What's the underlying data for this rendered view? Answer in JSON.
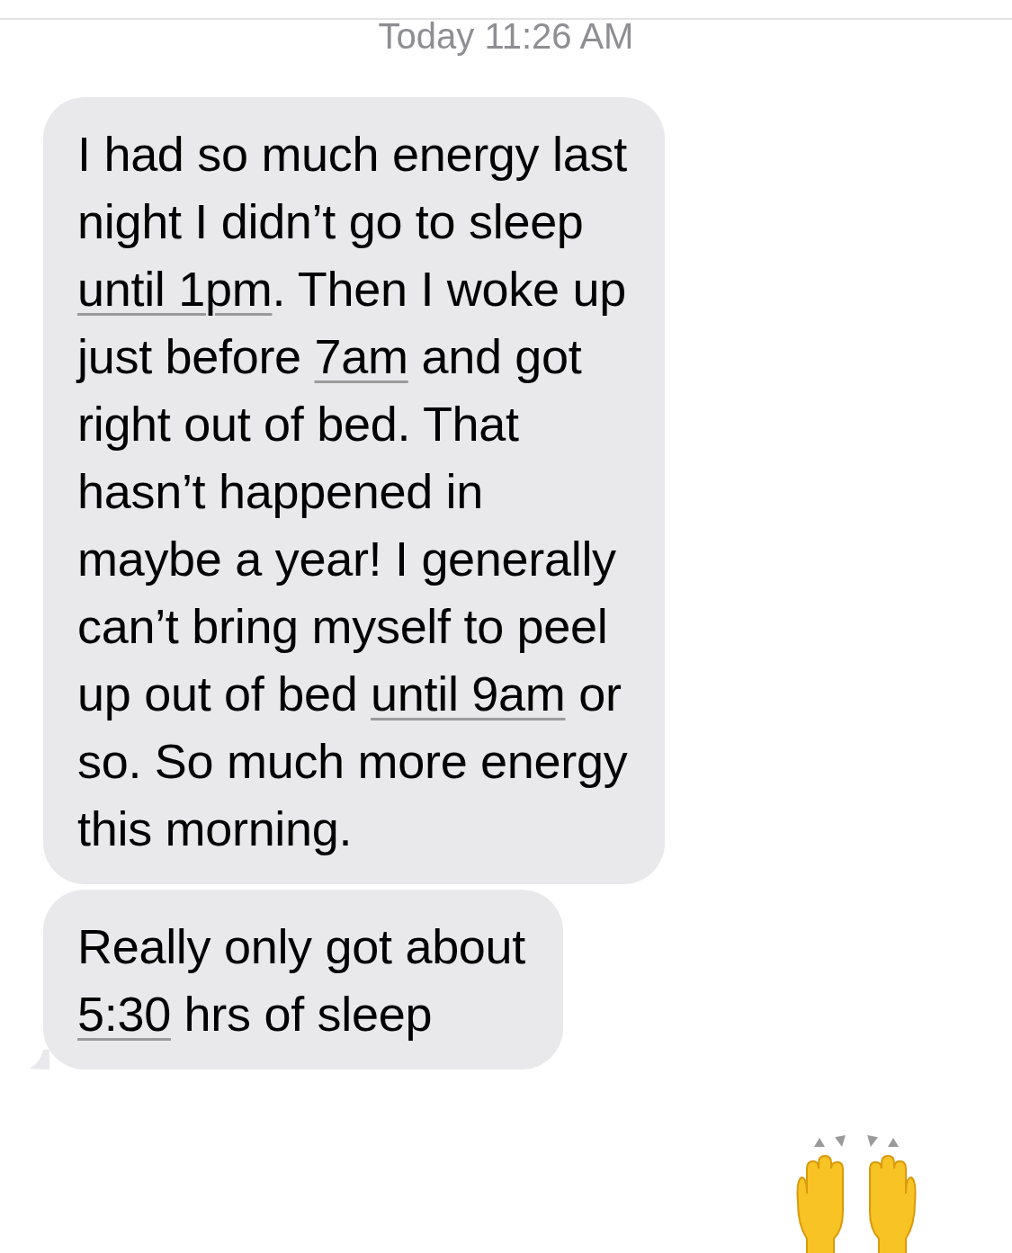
{
  "timestamp": {
    "day": "Today",
    "time": "11:26 AM"
  },
  "messages": [
    {
      "kind": "text",
      "tail": false,
      "parts": [
        {
          "kind": "text",
          "text": "I had so much energy last "
        },
        {
          "kind": "break"
        },
        {
          "kind": "text",
          "text": "night I didn’t go to sleep "
        },
        {
          "kind": "break"
        },
        {
          "kind": "link",
          "text": "until 1pm"
        },
        {
          "kind": "text",
          "text": ". Then I woke up "
        },
        {
          "kind": "break"
        },
        {
          "kind": "text",
          "text": "just before "
        },
        {
          "kind": "link",
          "text": "7am"
        },
        {
          "kind": "text",
          "text": " and got "
        },
        {
          "kind": "break"
        },
        {
          "kind": "text",
          "text": "right out of bed. That "
        },
        {
          "kind": "break"
        },
        {
          "kind": "text",
          "text": "hasn’t happened in "
        },
        {
          "kind": "break"
        },
        {
          "kind": "text",
          "text": "maybe a year! I generally "
        },
        {
          "kind": "break"
        },
        {
          "kind": "text",
          "text": "can’t bring myself to peel "
        },
        {
          "kind": "break"
        },
        {
          "kind": "text",
          "text": "up out of bed "
        },
        {
          "kind": "link",
          "text": "until 9am"
        },
        {
          "kind": "text",
          "text": " or "
        },
        {
          "kind": "break"
        },
        {
          "kind": "text",
          "text": "so. So much more energy "
        },
        {
          "kind": "break"
        },
        {
          "kind": "text",
          "text": "this morning."
        }
      ]
    },
    {
      "kind": "text",
      "tail": true,
      "parts": [
        {
          "kind": "text",
          "text": "Really only got about "
        },
        {
          "kind": "break"
        },
        {
          "kind": "link",
          "text": "5:30"
        },
        {
          "kind": "text",
          "text": " hrs of sleep"
        }
      ]
    },
    {
      "kind": "emoji"
    }
  ]
}
